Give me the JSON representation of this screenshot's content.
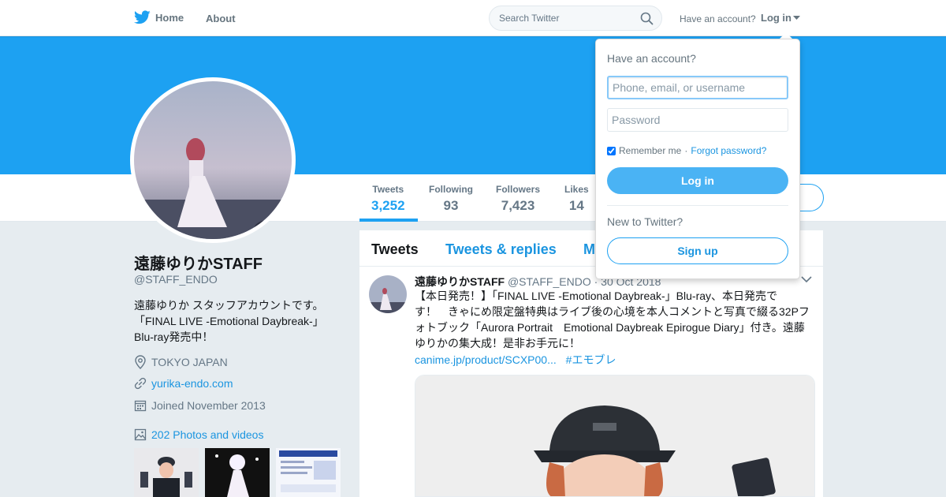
{
  "nav": {
    "home_label": "Home",
    "about_label": "About",
    "search_placeholder": "Search Twitter",
    "have_account": "Have an account?",
    "login_label": "Log in"
  },
  "colors": {
    "brand": "#1da1f2",
    "link": "#1b95e0",
    "page_bg": "#e6ecf0"
  },
  "profile": {
    "name": "遠藤ゆりかSTAFF",
    "handle": "@STAFF_ENDO",
    "bio_lines": [
      "遠藤ゆりか スタッフアカウントです。",
      "「FINAL LIVE -Emotional Daybreak-」",
      "Blu-ray発売中！"
    ],
    "location": "TOKYO JAPAN",
    "website": "yurika-endo.com",
    "joined": "Joined November 2013",
    "photos_label": "202 Photos and videos"
  },
  "stats": [
    {
      "label": "Tweets",
      "value": "3,252"
    },
    {
      "label": "Following",
      "value": "93"
    },
    {
      "label": "Followers",
      "value": "7,423"
    },
    {
      "label": "Likes",
      "value": "14"
    }
  ],
  "timeline": {
    "tabs": [
      "Tweets",
      "Tweets & replies",
      "M"
    ],
    "tweet": {
      "name": "遠藤ゆりかSTAFF",
      "handle": "@STAFF_ENDO",
      "date": "· 30 Oct 2018",
      "text_lines": [
        "【本日発売！】「FINAL LIVE -Emotional Daybreak-」Blu-ray、本日発売で",
        "す！　きゃにめ限定盤特典はライブ後の心境を本人コメントと写真で綴る32Pフ",
        "ォトブック「Aurora Portrait　Emotional Daybreak Epirogue Diary」付き。遠藤",
        "ゆりかの集大成！是非お手元に！"
      ],
      "link": "canime.jp/product/SCXP00...",
      "hashtag": "#エモブレ"
    }
  },
  "login_dropdown": {
    "title": "Have an account?",
    "username_placeholder": "Phone, email, or username",
    "password_placeholder": "Password",
    "remember": "Remember me",
    "separator": "·",
    "forgot": "Forgot password?",
    "login_button": "Log in",
    "new_to": "New to Twitter?",
    "signup_button": "Sign up"
  }
}
